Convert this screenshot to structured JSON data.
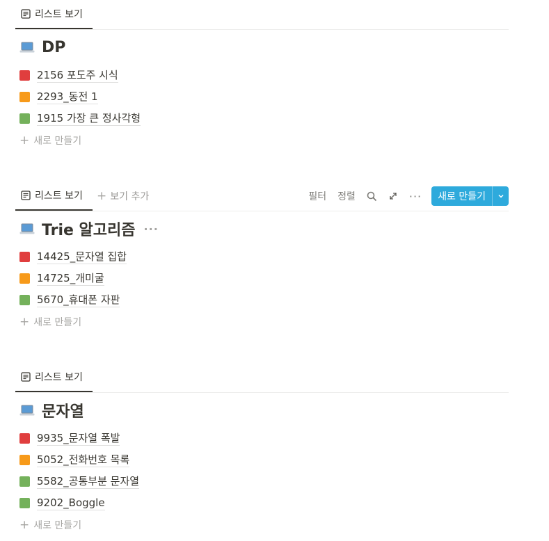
{
  "colors": {
    "red": "#e03e3e",
    "orange": "#f79a1a",
    "green": "#74b15b",
    "accent": "#2eaadc"
  },
  "sections": [
    {
      "tab_label": "리스트 보기",
      "title": "DP",
      "items": [
        {
          "label": "2156 포도주 시식",
          "color": "red"
        },
        {
          "label": "2293_동전 1",
          "color": "orange"
        },
        {
          "label": "1915 가장 큰 정사각형",
          "color": "green"
        }
      ],
      "new_label": "새로 만들기"
    },
    {
      "tab_label": "리스트 보기",
      "add_view_label": "보기 추가",
      "filter_label": "필터",
      "sort_label": "정렬",
      "new_button_label": "새로 만들기",
      "title": "Trie 알고리즘",
      "title_more": "···",
      "items": [
        {
          "label": "14425_문자열 집합",
          "color": "red"
        },
        {
          "label": "14725_개미굴",
          "color": "orange"
        },
        {
          "label": "5670_휴대폰 자판",
          "color": "green"
        }
      ],
      "new_label": "새로 만들기"
    },
    {
      "tab_label": "리스트 보기",
      "title": "문자열",
      "items": [
        {
          "label": "9935_문자열 폭발",
          "color": "red"
        },
        {
          "label": "5052_전화번호 목록",
          "color": "orange"
        },
        {
          "label": "5582_공통부분 문자열",
          "color": "green"
        },
        {
          "label": "9202_Boggle",
          "color": "green"
        }
      ],
      "new_label": "새로 만들기"
    }
  ],
  "icons": {
    "view": "list-view-icon",
    "page": "laptop-icon",
    "search": "search-icon",
    "expand": "expand-icon",
    "more": "more-icon",
    "chevron": "chevron-down-icon",
    "plus": "plus-icon"
  }
}
